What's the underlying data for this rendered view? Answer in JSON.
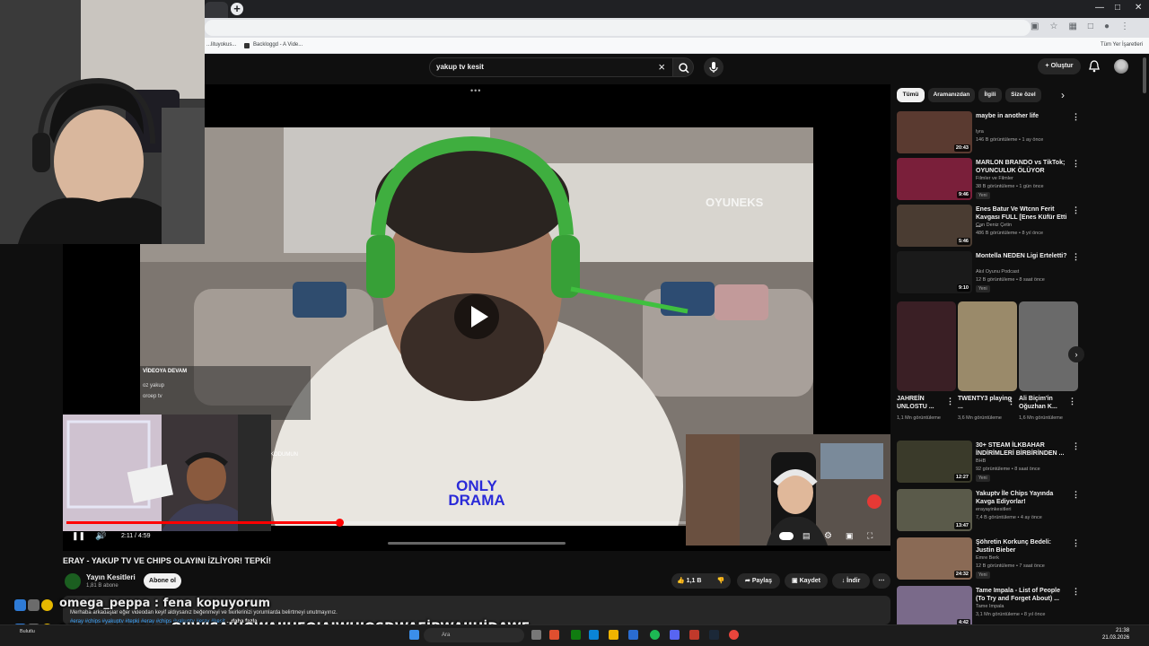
{
  "browser": {
    "bookmarks": [
      "...lituyokus...",
      "Backloggd - A Vide...",
      "Tüm Yer İşaretleri"
    ]
  },
  "header": {
    "search_value": "yakup tv kesit",
    "create_label": "Oluştur"
  },
  "player": {
    "time": "2:11 / 4:59",
    "progress": 0.44
  },
  "video": {
    "title": "ERAY - YAKUP TV VE CHIPS OLAYINI İZLİYOR! TEPKİ!",
    "channel": "Yayın Kesitleri",
    "subscribers": "1,81 B abone",
    "subscribe_label": "Abone ol",
    "likes": "1,1 B",
    "share_label": "Paylaş",
    "save_label": "Kaydet",
    "download_label": "İndir",
    "description": "Merhaba arkadaşlar eğer videodan keyif aldıysanız beğenmeyi ve fikirlerinizi yorumlarda belirtmeyi unutmayınız.",
    "tags": "#eray #chips #yakuptv #tepki #eray #chips #yakuptv #eray #kesit",
    "more_label": "...daha fazla"
  },
  "overlay": {
    "chat_line1": "omega_peppa : fena kopuyorum",
    "chat_line2": "omega_peppa : OIJWIŞAIHOWAIIHFOIAIWHIOŞDWAFİPWAIIHİDAWF",
    "video_chat_title": "VİDEOYA DEVAM",
    "video_chat_msgs": [
      "oz yakup",
      "oroep tv"
    ],
    "video_watermark": "OYUNEKS",
    "video_logo": "ONLY DRAMA",
    "video_label": "KODUMUN"
  },
  "chips": [
    "Tümü",
    "Aramanızdan",
    "İlgili",
    "Size özel"
  ],
  "recommendations": [
    {
      "title": "maybe in another life",
      "channel": "lyra",
      "meta": "146 B görüntüleme • 1 ay önce",
      "duration": "20:43",
      "new": false,
      "color": "#5a3a30"
    },
    {
      "title": "MARLON BRANDO vs TikTok; OYUNCULUK ÖLÜYOR",
      "channel": "Filmler ve Filmler",
      "meta": "38 B görüntüleme • 1 gün önce",
      "duration": "9:46",
      "new": true,
      "color": "#7a1f3a"
    },
    {
      "title": "Enes Batur Ve Wtcnn Ferit Kavgası FULL [Enes Küfür Etti ...",
      "channel": "Can Deniz Çetin",
      "meta": "486 B görüntüleme • 8 yıl önce",
      "duration": "5:46",
      "new": false,
      "color": "#4a3c32"
    },
    {
      "title": "Montella NEDEN Ligi Erteletti?",
      "channel": "Akıl Oyunu Podcast",
      "meta": "12 B görüntüleme • 8 saat önce",
      "duration": "9:10",
      "new": true,
      "color": "#1a1a1a"
    }
  ],
  "shorts": [
    {
      "title": "JAHREİN UNLOSTU ...",
      "views": "1,1 Mn görüntüleme",
      "color": "#3a1f25"
    },
    {
      "title": "TWENTY3 playing ...",
      "views": "3,6 Mn görüntüleme",
      "color": "#9a8a6a"
    },
    {
      "title": "Ali Biçim'in Oğuzhan K...",
      "views": "1,6 Mn görüntüleme",
      "color": "#6a6a6a"
    }
  ],
  "recommendations2": [
    {
      "title": "30+ STEAM İLKBAHAR İNDİRİMLERİ BİRBİRİNDEN ...",
      "channel": "BHB",
      "meta": "92 görüntüleme • 8 saat önce",
      "duration": "12:27",
      "new": true,
      "color": "#3a3a2a"
    },
    {
      "title": "Yakuptv İle Chips Yayında Kavga Ediyorlar!",
      "channel": "erayayinkesitleri",
      "meta": "7,4 B görüntüleme • 4 ay önce",
      "duration": "13:47",
      "new": false,
      "color": "#5a5a4a"
    },
    {
      "title": "Şöhretin Korkunç Bedeli: Justin Bieber",
      "channel": "Emre Berk",
      "meta": "12 B görüntüleme • 7 saat önce",
      "duration": "24:32",
      "new": true,
      "color": "#8a6a55"
    },
    {
      "title": "Tame Impala - List of People (To Try and Forget About) ...",
      "channel": "Tame Impala",
      "meta": "3,1 Mn görüntüleme • 8 yıl önce",
      "duration": "4:42",
      "new": false,
      "color": "#7a6a8a"
    }
  ],
  "taskbar": {
    "weather": "Bulutlu",
    "search_placeholder": "Ara",
    "time": "21:38",
    "date": "21.03.2026"
  }
}
